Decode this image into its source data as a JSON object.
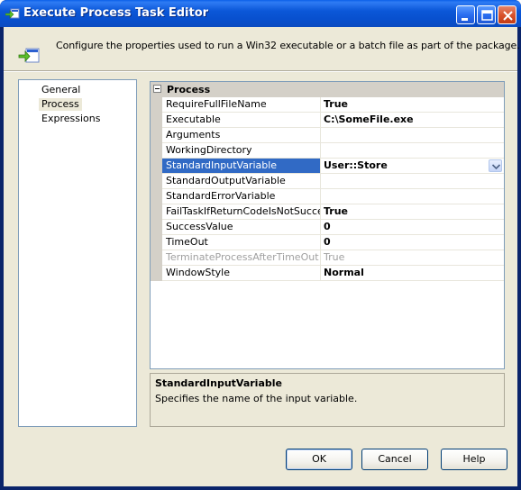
{
  "window": {
    "title": "Execute Process Task Editor",
    "titlebar_color": "#0a58d8"
  },
  "header": {
    "description": "Configure the properties used to run a Win32 executable or a batch file as part of the package.",
    "icon": "execute-process-icon"
  },
  "nav": {
    "items": [
      {
        "label": "General",
        "selected": false
      },
      {
        "label": "Process",
        "selected": true
      },
      {
        "label": "Expressions",
        "selected": false
      }
    ]
  },
  "grid": {
    "category": "Process",
    "rows": [
      {
        "name": "RequireFullFileName",
        "value": "True"
      },
      {
        "name": "Executable",
        "value": "C:\\SomeFile.exe"
      },
      {
        "name": "Arguments",
        "value": ""
      },
      {
        "name": "WorkingDirectory",
        "value": ""
      },
      {
        "name": "StandardInputVariable",
        "value": "User::Store"
      },
      {
        "name": "StandardOutputVariable",
        "value": ""
      },
      {
        "name": "StandardErrorVariable",
        "value": ""
      },
      {
        "name": "FailTaskIfReturnCodeIsNotSuccessValue",
        "value": "True"
      },
      {
        "name": "SuccessValue",
        "value": "0"
      },
      {
        "name": "TimeOut",
        "value": "0"
      },
      {
        "name": "TerminateProcessAfterTimeOut",
        "value": "True"
      },
      {
        "name": "WindowStyle",
        "value": "Normal"
      }
    ],
    "selected_color": "#316ac5"
  },
  "description_panel": {
    "title": "StandardInputVariable",
    "text": "Specifies the name of the input variable."
  },
  "buttons": {
    "ok": "OK",
    "cancel": "Cancel",
    "help": "Help"
  }
}
